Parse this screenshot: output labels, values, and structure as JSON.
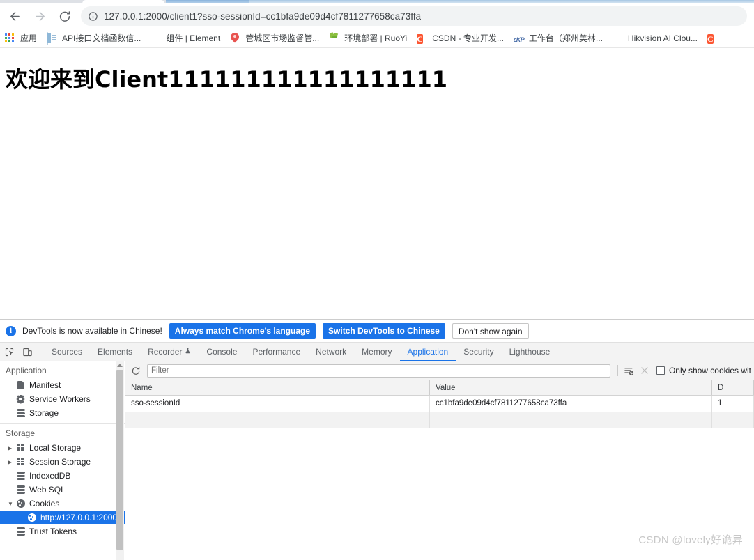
{
  "browser": {
    "nav": {
      "back_label": "Back",
      "forward_label": "Forward",
      "reload_label": "Reload"
    },
    "omnibox": {
      "url": "127.0.0.1:2000/client1?sso-sessionId=cc1bfa9de09d4cf7811277658ca73ffa",
      "site_info_icon": "info-circle-icon"
    },
    "bookmarks": [
      {
        "label": "应用",
        "icon": "apps-grid-icon"
      },
      {
        "label": "API接口文档函数信...",
        "icon": "document-icon"
      },
      {
        "label": "组件 | Element",
        "icon": "element-ui-icon"
      },
      {
        "label": "管城区市场监督管...",
        "icon": "map-pin-icon"
      },
      {
        "label": "环境部署 | RuoYi",
        "icon": "leaf-icon"
      },
      {
        "label": "CSDN - 专业开发...",
        "icon": "csdn-icon"
      },
      {
        "label": "工作台（郑州美林...",
        "icon": "ekp-icon"
      },
      {
        "label": "Hikvision AI Clou...",
        "icon": "hikvision-icon"
      },
      {
        "label": "",
        "icon": "csdn-icon-cutoff"
      }
    ]
  },
  "page": {
    "heading": "欢迎来到Client111111111111111111"
  },
  "devtools": {
    "language_banner": {
      "message": "DevTools is now available in Chinese!",
      "info_icon": "info-icon",
      "buttons": [
        {
          "label": "Always match Chrome's language",
          "style": "primary"
        },
        {
          "label": "Switch DevTools to Chinese",
          "style": "primary"
        },
        {
          "label": "Don't show again",
          "style": "ghost"
        }
      ]
    },
    "toolbar_icons": [
      {
        "name": "inspect-element-icon"
      },
      {
        "name": "device-toolbar-icon"
      }
    ],
    "tabs": [
      {
        "label": "Sources",
        "active": false
      },
      {
        "label": "Elements",
        "active": false
      },
      {
        "label": "Recorder",
        "active": false,
        "badge_icon": "flask-icon"
      },
      {
        "label": "Console",
        "active": false
      },
      {
        "label": "Performance",
        "active": false
      },
      {
        "label": "Network",
        "active": false
      },
      {
        "label": "Memory",
        "active": false
      },
      {
        "label": "Application",
        "active": true
      },
      {
        "label": "Security",
        "active": false
      },
      {
        "label": "Lighthouse",
        "active": false
      }
    ],
    "sidebar": {
      "section_application": {
        "title": "Application",
        "items": [
          {
            "label": "Manifest",
            "icon": "page-icon"
          },
          {
            "label": "Service Workers",
            "icon": "gear-icon"
          },
          {
            "label": "Storage",
            "icon": "database-icon"
          }
        ]
      },
      "section_storage": {
        "title": "Storage",
        "items": [
          {
            "label": "Local Storage",
            "icon": "table-icon",
            "twisty": "▶",
            "indent": 0
          },
          {
            "label": "Session Storage",
            "icon": "table-icon",
            "twisty": "▶",
            "indent": 0
          },
          {
            "label": "IndexedDB",
            "icon": "database-icon",
            "twisty": "",
            "indent": 0
          },
          {
            "label": "Web SQL",
            "icon": "database-icon",
            "twisty": "",
            "indent": 0
          },
          {
            "label": "Cookies",
            "icon": "cookie-icon",
            "twisty": "▼",
            "indent": 0
          },
          {
            "label": "http://127.0.0.1:2000",
            "icon": "cookie-icon",
            "twisty": "",
            "indent": 1,
            "selected": true
          },
          {
            "label": "Trust Tokens",
            "icon": "database-icon",
            "twisty": "",
            "indent": 0
          }
        ]
      }
    },
    "cookie_toolbar": {
      "refresh_icon": "refresh-icon",
      "filter_placeholder": "Filter",
      "filter_value": "",
      "clear_filtered_icon": "clear-filtered-cookies-icon",
      "clear_all_icon": "clear-all-cookies-icon",
      "only_show_label": "Only show cookies wit",
      "only_show_checked": false
    },
    "cookie_table": {
      "columns": [
        "Name",
        "Value",
        "D"
      ],
      "rows": [
        {
          "name": "sso-sessionId",
          "value": "cc1bfa9de09d4cf7811277658ca73ffa",
          "domain": "1"
        }
      ]
    }
  },
  "watermark": {
    "text": "CSDN @lovely好诡异"
  },
  "colors": {
    "accent_blue": "#1a73e8",
    "toolbar_gray": "#f3f3f3",
    "selected_row": "#1a73e8"
  }
}
